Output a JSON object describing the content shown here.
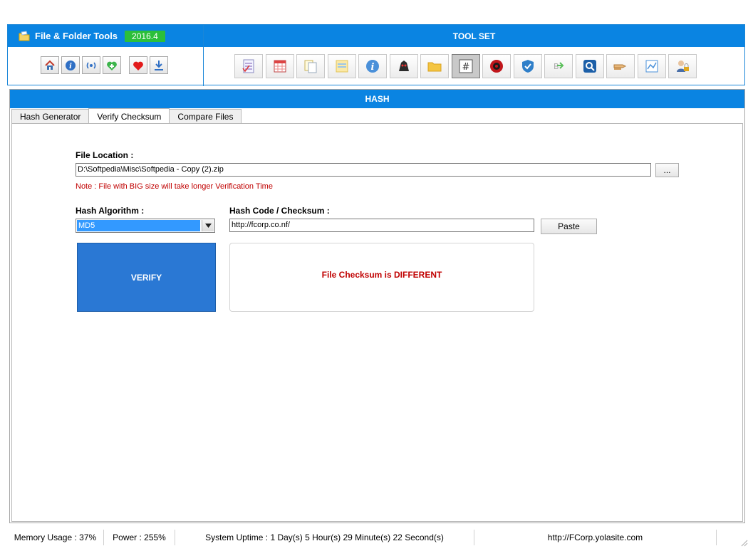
{
  "header": {
    "app_title": "File & Folder Tools",
    "version": "2016.4",
    "toolset_title": "TOOL SET",
    "nav_icons": [
      "home-icon",
      "info-icon",
      "broadcast-icon",
      "add-icon",
      "heart-icon",
      "download-icon"
    ],
    "tool_icons": [
      "checklist-icon",
      "calendar-icon",
      "copy-files-icon",
      "notes-icon",
      "info-icon",
      "monitor-icon",
      "folder-icon",
      "hash-icon",
      "target-icon",
      "shield-icon",
      "rename-icon",
      "search-icon",
      "pointer-icon",
      "chart-icon",
      "user-lock-icon"
    ]
  },
  "panel": {
    "title": "HASH",
    "tabs": [
      {
        "label": "Hash Generator",
        "active": false
      },
      {
        "label": "Verify Checksum",
        "active": true
      },
      {
        "label": "Compare Files",
        "active": false
      }
    ]
  },
  "form": {
    "file_location_label": "File Location :",
    "file_location_value": "D:\\Softpedia\\Misc\\Softpedia - Copy (2).zip",
    "browse_label": "...",
    "note": "Note : File with BIG size will take longer Verification Time",
    "algorithm_label": "Hash Algorithm :",
    "algorithm_value": "MD5",
    "checksum_label": "Hash Code / Checksum :",
    "checksum_value": "http://fcorp.co.nf/",
    "paste_label": "Paste",
    "verify_label": "VERIFY",
    "result_text": "File Checksum is DIFFERENT"
  },
  "status": {
    "memory": "Memory Usage : 37%",
    "power": "Power : 255%",
    "uptime": "System Uptime : 1 Day(s) 5 Hour(s) 29 Minute(s) 22 Second(s)",
    "website": "http://FCorp.yolasite.com"
  },
  "colors": {
    "header_blue": "#0a84e2",
    "version_green": "#2bbf3a",
    "verify_blue": "#2a78d4",
    "result_red": "#c00000"
  }
}
